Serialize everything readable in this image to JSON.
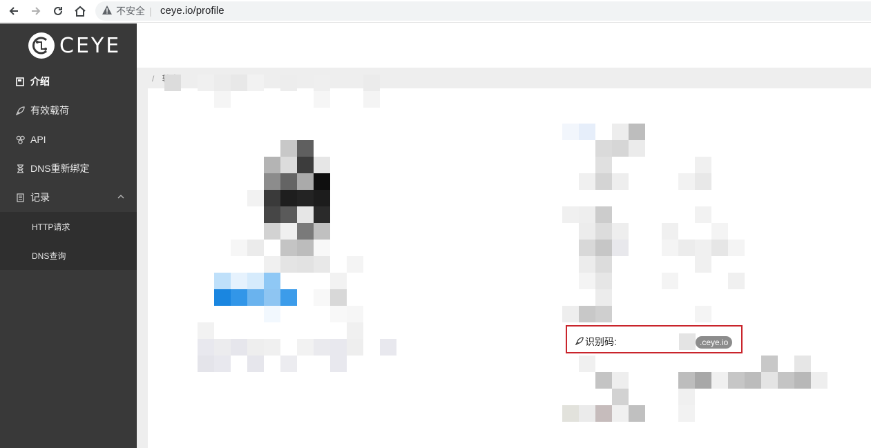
{
  "browser": {
    "back_icon": "arrow-left-icon",
    "forward_icon": "arrow-right-icon",
    "reload_icon": "reload-icon",
    "home_icon": "home-icon",
    "security_text": "不安全",
    "url": "ceye.io/profile"
  },
  "sidebar": {
    "logo_text": "CEYE",
    "items": [
      {
        "label": "介绍",
        "icon": "book-icon"
      },
      {
        "label": "有效载荷",
        "icon": "rocket-icon"
      },
      {
        "label": "API",
        "icon": "api-icon"
      },
      {
        "label": "DNS重新绑定",
        "icon": "hourglass-icon"
      },
      {
        "label": "记录",
        "icon": "list-icon"
      }
    ],
    "sub_items": [
      {
        "label": "HTTP请求"
      },
      {
        "label": "DNS查询"
      }
    ]
  },
  "breadcrumb": {
    "separator": "/",
    "current": "轮廓"
  },
  "identifier": {
    "label": "识别码:",
    "domain_suffix": ".ceye.io"
  },
  "colors": {
    "sidebar_bg": "#393939",
    "submenu_bg": "#2f2f2f",
    "highlight_border": "#c9242b",
    "domain_pill": "#8c8c8c"
  }
}
